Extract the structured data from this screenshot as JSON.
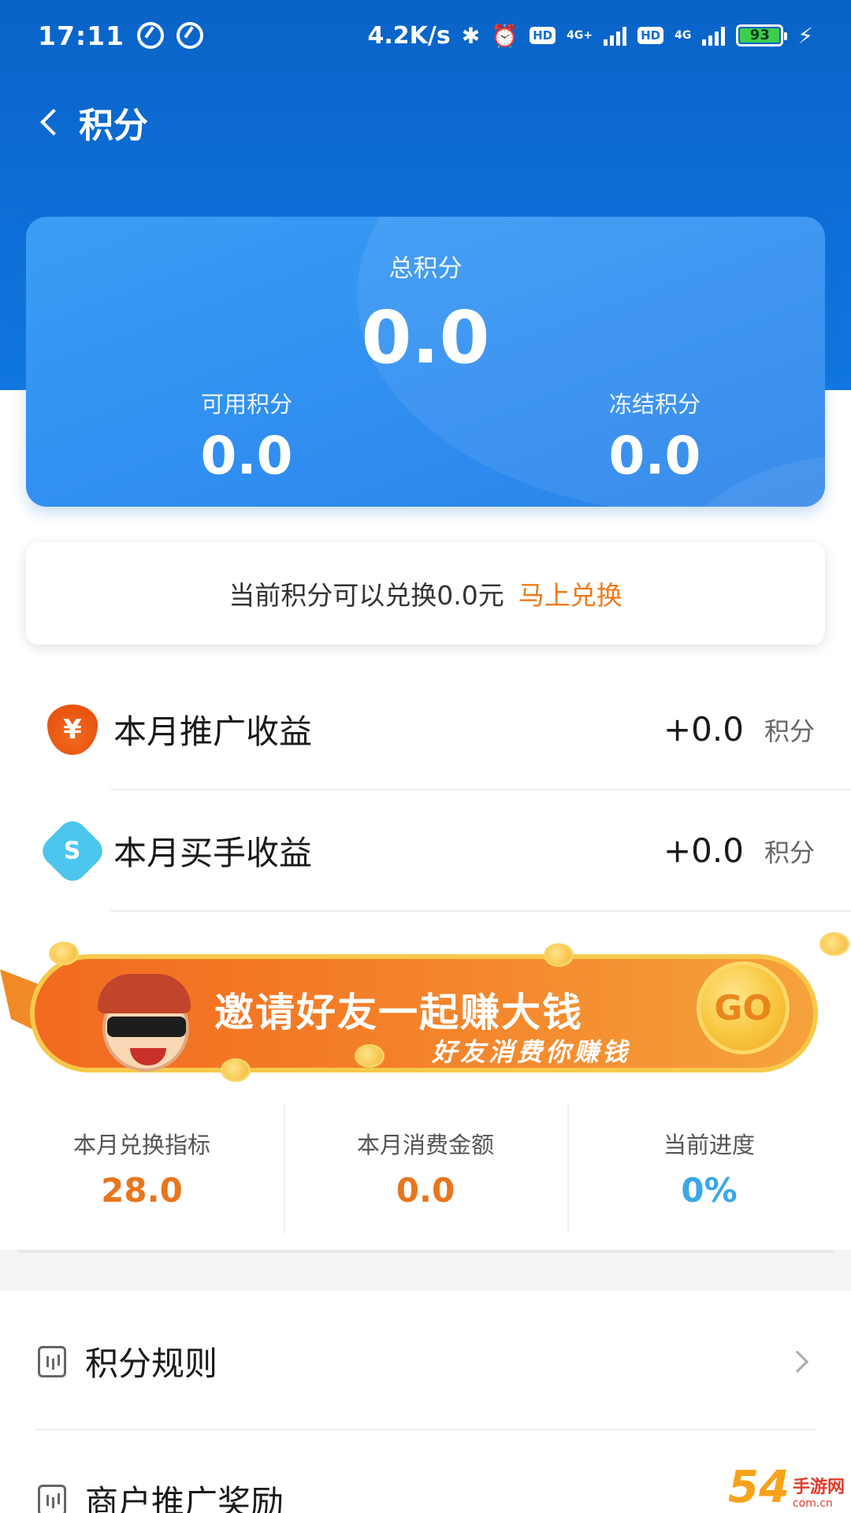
{
  "status_bar": {
    "time": "17:11",
    "net_speed": "4.2K/s",
    "bluetooth_glyph": "✱",
    "alarm_glyph": "⏰",
    "hd_label": "HD",
    "net_type_1": "4G+",
    "net_type_2": "4G",
    "battery_level": "93",
    "charging_glyph": "⚡"
  },
  "nav": {
    "title": "积分"
  },
  "points_card": {
    "total_label": "总积分",
    "total_value": "0.0",
    "available_label": "可用积分",
    "available_value": "0.0",
    "frozen_label": "冻结积分",
    "frozen_value": "0.0"
  },
  "exchange": {
    "text": "当前积分可以兑换0.0元",
    "link": "马上兑换"
  },
  "earnings": [
    {
      "icon": "fire-yen-icon",
      "glyph": "¥",
      "label": "本月推广收益",
      "value": "+0.0",
      "unit": "积分"
    },
    {
      "icon": "buyer-badge-icon",
      "glyph": "S",
      "label": "本月买手收益",
      "value": "+0.0",
      "unit": "积分"
    }
  ],
  "banner": {
    "title": "邀请好友一起赚大钱",
    "subtitle": "好友消费你赚钱",
    "go_label": "GO"
  },
  "stats": [
    {
      "label": "本月兑换指标",
      "value": "28.0",
      "color": "#e8761e"
    },
    {
      "label": "本月消费金额",
      "value": "0.0",
      "color": "#e8761e"
    },
    {
      "label": "当前进度",
      "value": "0%",
      "color": "#3aa7e6"
    }
  ],
  "menu": [
    {
      "label": "积分规则",
      "icon": "rules-chart-icon"
    },
    {
      "label": "商户推广奖励",
      "icon": "merchant-icon"
    }
  ],
  "watermark": {
    "logo": "54",
    "name": "手游网",
    "domain": "com.cn"
  },
  "colors": {
    "header_blue": "#0d6fd8",
    "card_blue": "#2f8df0",
    "accent_orange": "#ef7a1a",
    "progress_blue": "#3aa7e6"
  }
}
